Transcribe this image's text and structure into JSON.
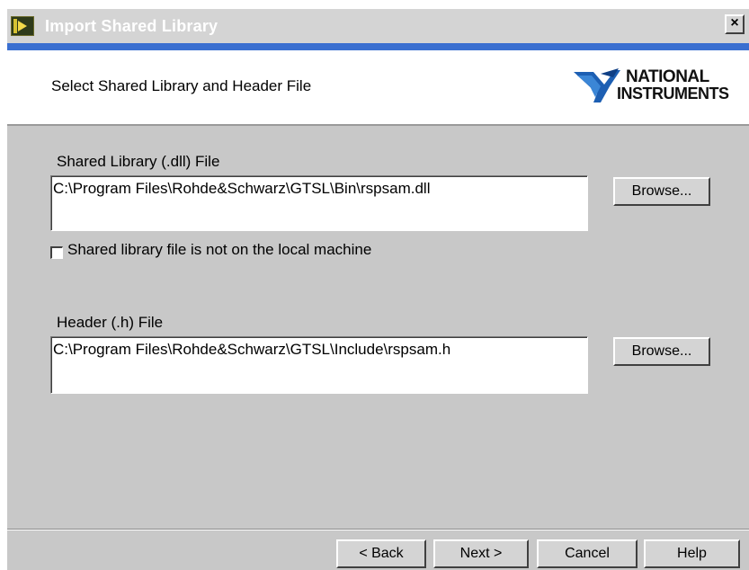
{
  "window": {
    "title": "Import Shared Library",
    "close_label": "×"
  },
  "header": {
    "title": "Select Shared Library and Header File",
    "logo_line1": "NATIONAL",
    "logo_line2": "INSTRUMENTS"
  },
  "shared_library": {
    "label": "Shared Library (.dll) File",
    "value": "C:\\Program Files\\Rohde&Schwarz\\GTSL\\Bin\\rspsam.dll",
    "browse_label": "Browse...",
    "not_local_checkbox_label": "Shared library file is not on the local machine",
    "not_local_checked": false
  },
  "header_file": {
    "label": "Header (.h) File",
    "value": "C:\\Program Files\\Rohde&Schwarz\\GTSL\\Include\\rspsam.h",
    "browse_label": "Browse..."
  },
  "footer": {
    "back_label": "< Back",
    "next_label": "Next >",
    "cancel_label": "Cancel",
    "help_label": "Help"
  },
  "colors": {
    "title_accent": "#3a6fd0",
    "dialog_bg": "#c8c8c8"
  },
  "icons": {
    "window_icon": "labview-vi-icon",
    "logo": "national-instruments-eagle-logo"
  }
}
